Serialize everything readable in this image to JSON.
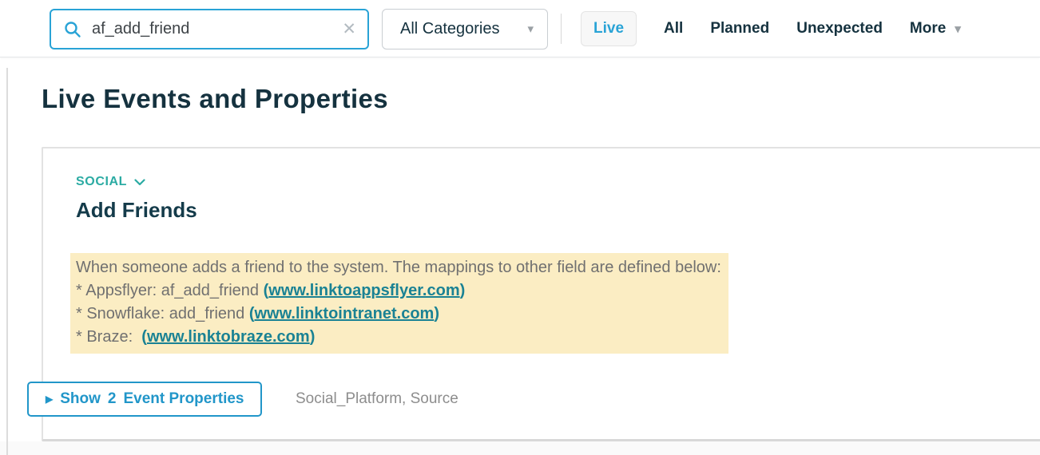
{
  "colors": {
    "accent-blue": "#29A3D6",
    "button-blue": "#2196C9",
    "navy": "#15323F",
    "category-teal": "#2BABA3",
    "link-teal": "#1A8294",
    "desc-bg": "#FBEDC3",
    "desc-text": "#707070",
    "muted-gray": "#8D8D8D"
  },
  "icons": {
    "search": "magnifier",
    "clear": "✕",
    "caret_down": "▾",
    "chevron_down": "chevron",
    "expand_arrow": "▶"
  },
  "topbar": {
    "search": {
      "value": "af_add_friend"
    },
    "categories_dropdown": {
      "label": "All Categories"
    },
    "filters": {
      "live": "Live",
      "all": "All",
      "planned": "Planned",
      "unexpected": "Unexpected",
      "more": "More"
    }
  },
  "page": {
    "title": "Live Events and Properties"
  },
  "card": {
    "category": {
      "label": "SOCIAL"
    },
    "event_name": "Add Friends",
    "description": {
      "line1": "When someone adds a friend to the system. The mappings to other field are defined below:",
      "line2": {
        "pre": "* Appsflyer: af_add_friend ",
        "open": "(",
        "link": "www.linktoappsflyer.com",
        "close": ")"
      },
      "line3": {
        "pre": "* Snowflake: add_friend ",
        "open": "(",
        "link": "www.linktointranet.com",
        "close": ")"
      },
      "line4": {
        "pre": "* Braze:  ",
        "open": "(",
        "link": "www.linktobraze.com",
        "close": ")"
      }
    },
    "properties": {
      "toggle_label": {
        "pre": "Show",
        "count": "2",
        "post": "Event Properties"
      },
      "preview": "Social_Platform, Source"
    }
  }
}
